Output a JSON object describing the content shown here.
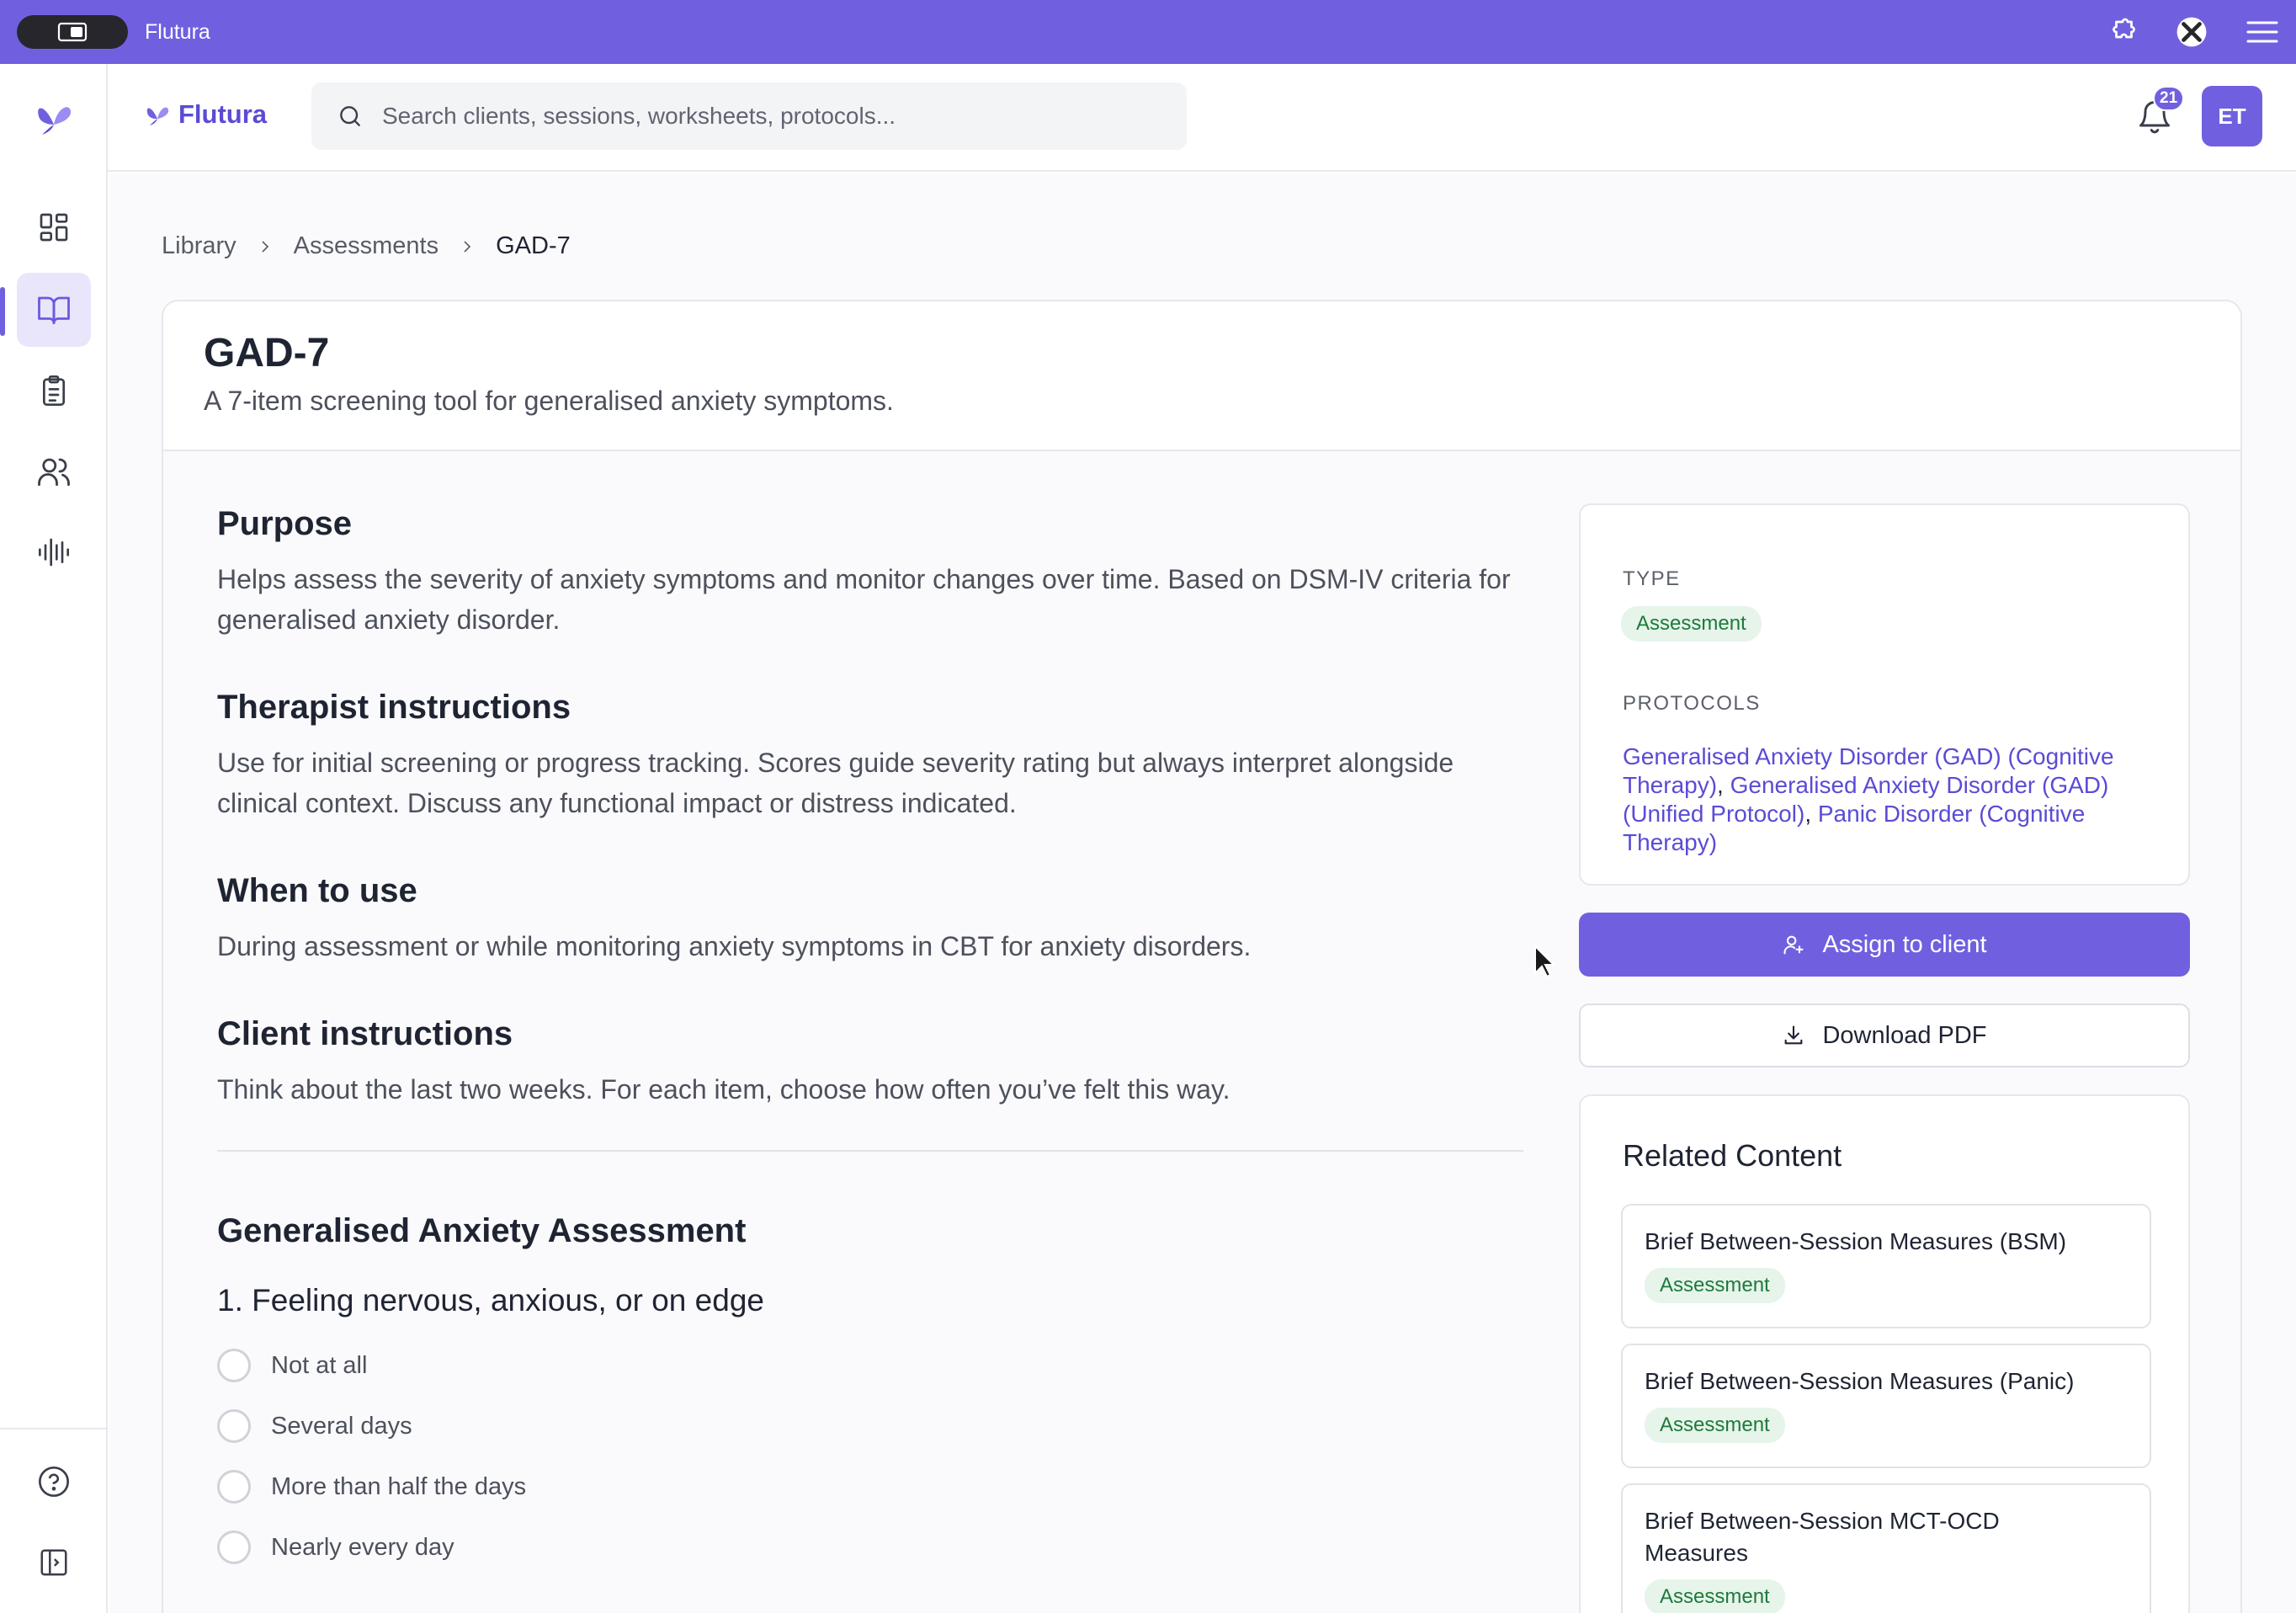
{
  "window": {
    "title": "Flutura"
  },
  "header": {
    "brand": "Flutura",
    "search_placeholder": "Search clients, sessions, worksheets, protocols...",
    "notification_count": "21",
    "avatar_initials": "ET"
  },
  "breadcrumb": {
    "items": [
      "Library",
      "Assessments",
      "GAD-7"
    ]
  },
  "page": {
    "title": "GAD-7",
    "subtitle": "A 7-item screening tool for generalised anxiety symptoms."
  },
  "sections": [
    {
      "heading": "Purpose",
      "body": "Helps assess the severity of anxiety symptoms and monitor changes over time. Based on DSM-IV criteria for generalised anxiety disorder."
    },
    {
      "heading": "Therapist instructions",
      "body": "Use for initial screening or progress tracking. Scores guide severity rating but always interpret alongside clinical context. Discuss any functional impact or distress indicated."
    },
    {
      "heading": "When to use",
      "body": "During assessment or while monitoring anxiety symptoms in CBT for anxiety disorders."
    },
    {
      "heading": "Client instructions",
      "body": "Think about the last two weeks. For each item, choose how often you’ve felt this way."
    }
  ],
  "assessment": {
    "title": "Generalised Anxiety Assessment",
    "question": "1. Feeling nervous, anxious, or on edge",
    "options": [
      "Not at all",
      "Several days",
      "More than half the days",
      "Nearly every day"
    ]
  },
  "meta": {
    "type_label": "TYPE",
    "type_value": "Assessment",
    "protocols_label": "PROTOCOLS",
    "protocols": [
      "Generalised Anxiety Disorder (GAD) (Cognitive Therapy)",
      "Generalised Anxiety Disorder (GAD) (Unified Protocol)",
      "Panic Disorder (Cognitive Therapy)"
    ],
    "protocol_separator": ","
  },
  "actions": {
    "assign_label": "Assign to client",
    "download_label": "Download PDF"
  },
  "related": {
    "heading": "Related Content",
    "items": [
      {
        "title": "Brief Between-Session Measures (BSM)",
        "tag": "Assessment"
      },
      {
        "title": "Brief Between-Session Measures (Panic)",
        "tag": "Assessment"
      },
      {
        "title": "Brief Between-Session MCT-OCD Measures",
        "tag": "Assessment"
      }
    ]
  },
  "colors": {
    "accent": "#7060e0",
    "link": "#5a4bd6",
    "tag_bg": "#e6f4ea",
    "tag_text": "#1e7a3c"
  }
}
